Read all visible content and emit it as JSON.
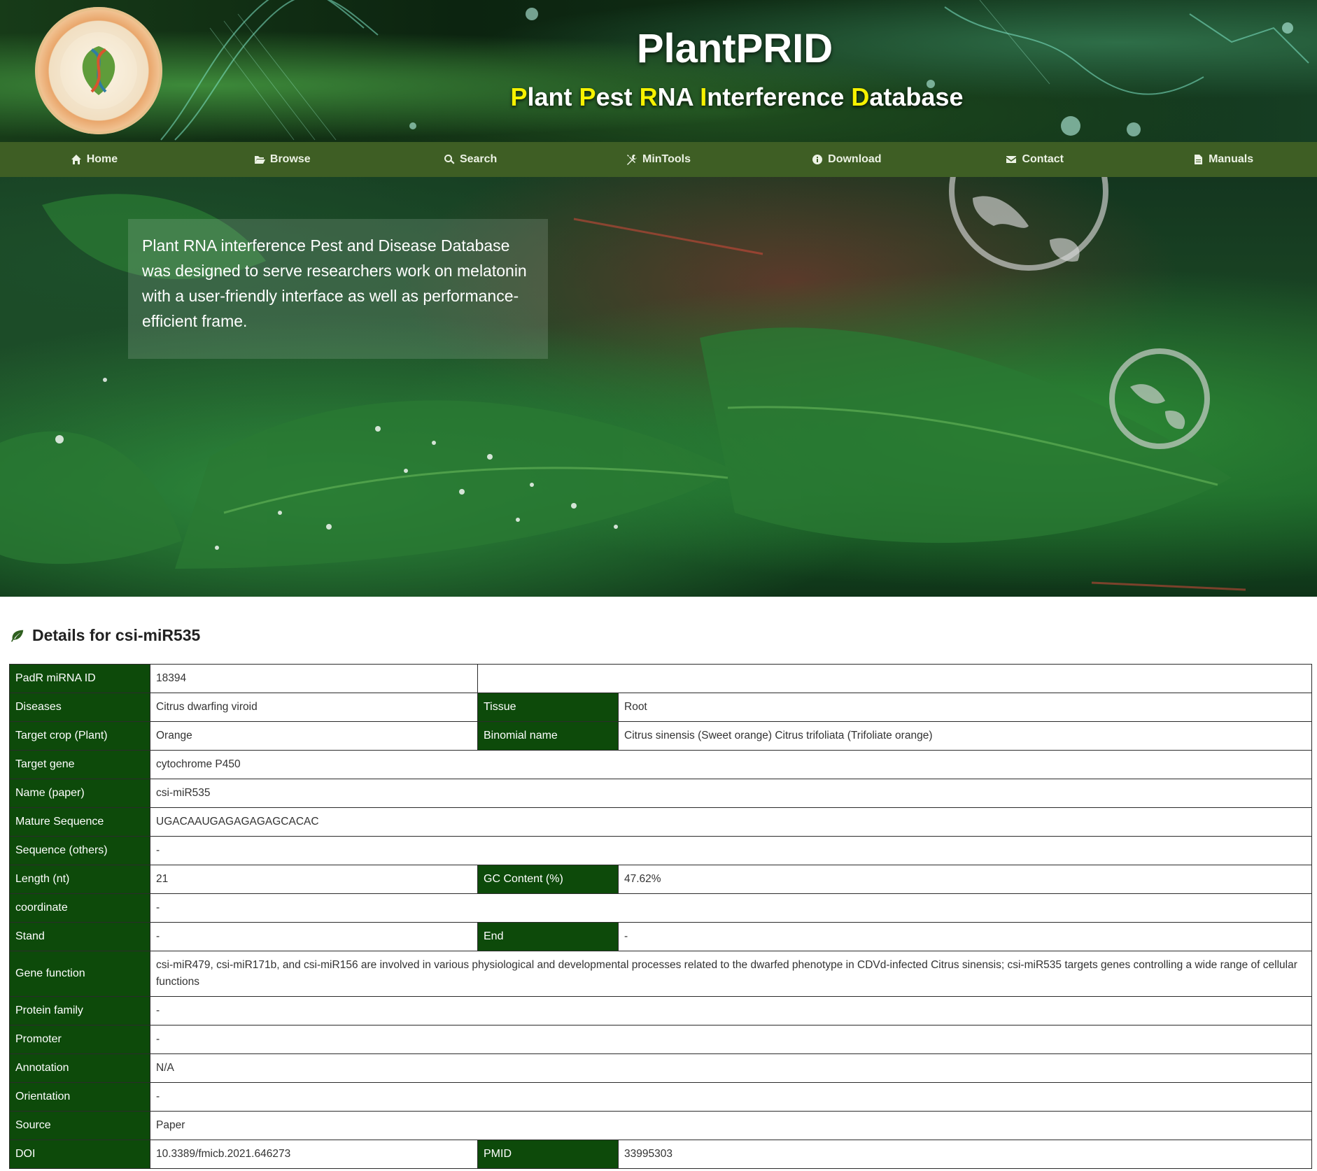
{
  "header": {
    "title": "PlantPRID",
    "subtitle_parts": [
      {
        "text": "P",
        "highlight": true
      },
      {
        "text": "lant ",
        "highlight": false
      },
      {
        "text": "P",
        "highlight": true
      },
      {
        "text": "est ",
        "highlight": false
      },
      {
        "text": "R",
        "highlight": true
      },
      {
        "text": "NA ",
        "highlight": false
      },
      {
        "text": "I",
        "highlight": true
      },
      {
        "text": "nterference ",
        "highlight": false
      },
      {
        "text": "D",
        "highlight": true
      },
      {
        "text": "atabase",
        "highlight": false
      }
    ],
    "highlight_color": "#f6f200"
  },
  "nav": {
    "home": "Home",
    "browse": "Browse",
    "search": "Search",
    "mintools": "MinTools",
    "download": "Download",
    "contact": "Contact",
    "manuals": "Manuals"
  },
  "hero": {
    "intro": "Plant RNA interference Pest and Disease Database was designed to serve researchers work on melatonin with a user-friendly interface as well as performance-efficient frame."
  },
  "details": {
    "heading": "Details for csi-miR535",
    "rows": {
      "id": {
        "label": "PadR miRNA ID",
        "value": "18394"
      },
      "diseases": {
        "label": "Diseases",
        "value": "Citrus dwarfing viroid"
      },
      "tissue": {
        "label": "Tissue",
        "value": "Root"
      },
      "crop": {
        "label": "Target crop (Plant)",
        "value": "Orange"
      },
      "binomial": {
        "label": "Binomial name",
        "value": "Citrus sinensis (Sweet orange) Citrus trifoliata (Trifoliate orange)"
      },
      "gene": {
        "label": "Target gene",
        "value": "cytochrome P450"
      },
      "name": {
        "label": "Name (paper)",
        "value": "csi-miR535"
      },
      "mature": {
        "label": "Mature Sequence",
        "value": "UGACAAUGAGAGAGAGCACAC"
      },
      "seq_others": {
        "label": "Sequence (others)",
        "value": "-"
      },
      "length": {
        "label": "Length (nt)",
        "value": "21"
      },
      "gc": {
        "label": "GC Content (%)",
        "value": "47.62%"
      },
      "coordinate": {
        "label": "coordinate",
        "value": "-"
      },
      "stand": {
        "label": "Stand",
        "value": "-"
      },
      "end": {
        "label": "End",
        "value": "-"
      },
      "function": {
        "label": "Gene function",
        "value": "csi-miR479, csi-miR171b, and csi-miR156 are involved in various physiological and developmental processes related to the dwarfed phenotype in CDVd-infected Citrus sinensis; csi-miR535 targets genes controlling a wide range of cellular functions"
      },
      "family": {
        "label": "Protein family",
        "value": "-"
      },
      "promoter": {
        "label": "Promoter",
        "value": "-"
      },
      "annotation": {
        "label": "Annotation",
        "value": "N/A"
      },
      "orientation": {
        "label": "Orientation",
        "value": "-"
      },
      "source": {
        "label": "Source",
        "value": "Paper"
      },
      "doi": {
        "label": "DOI",
        "value": "10.3389/fmicb.2021.646273"
      },
      "pmid": {
        "label": "PMID",
        "value": "33995303"
      }
    }
  },
  "colors": {
    "nav_bg": "#3e5e24",
    "label_bg": "#0d4a0a"
  }
}
